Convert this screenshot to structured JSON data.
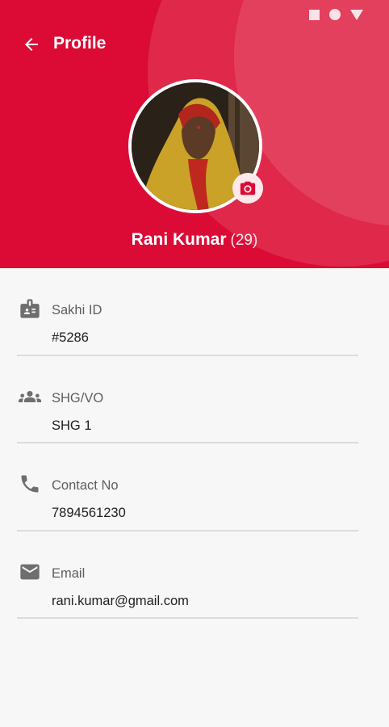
{
  "status_bar": {
    "icons": [
      "square-icon",
      "circle-icon",
      "triangle-icon"
    ]
  },
  "header": {
    "title": "Profile",
    "back_icon": "arrow-back-icon",
    "background": "#db0b36"
  },
  "profile": {
    "name": "Rani Kumar",
    "age": "(29)",
    "camera_icon": "camera-icon"
  },
  "fields": [
    {
      "icon": "id-badge-icon",
      "label": "Sakhi ID",
      "value": "#5286"
    },
    {
      "icon": "group-icon",
      "label": "SHG/VO",
      "value": "SHG 1"
    },
    {
      "icon": "phone-icon",
      "label": "Contact No",
      "value": "7894561230"
    },
    {
      "icon": "email-icon",
      "label": "Email",
      "value": "rani.kumar@gmail.com"
    }
  ]
}
